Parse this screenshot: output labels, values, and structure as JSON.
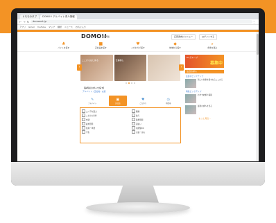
{
  "browser": {
    "tabs": [
      {
        "title": "ドモモのタブ"
      },
      {
        "title": "DOMO!! アルバイト求人情報"
      }
    ],
    "url": "domonet.jp",
    "bookmarks": [
      "アプリ",
      "Gmail",
      "YouTube",
      "マップ",
      "翻訳",
      "ニュース",
      "お気に入り"
    ]
  },
  "site": {
    "logo": "DOMO!!",
    "logo_sub": "静岡版",
    "header_buttons": [
      "応募者向けメニュー",
      "ログインする"
    ],
    "categories": [
      {
        "icon": "leaf-icon",
        "label": "バイトを探す"
      },
      {
        "icon": "case-icon",
        "label": "正社員を探す"
      },
      {
        "icon": "heart-icon",
        "label": "こだわりで探す"
      },
      {
        "icon": "map-icon",
        "label": "地域から探す"
      },
      {
        "icon": "search-icon",
        "label": "条件を選ぶ"
      }
    ],
    "hero": {
      "slides": [
        {
          "text": "ここからはじめる"
        },
        {
          "text": "仕事探し"
        },
        {
          "text": ""
        }
      ],
      "prev": "‹",
      "next": "›"
    },
    "promo_text": "【静岡県の求人を探す】",
    "promo_tags": "アルバイト / 正社員 / 派遣",
    "job_tabs": [
      {
        "icon": "paper-icon",
        "label": "アルバイト"
      },
      {
        "icon": "briefcase-icon",
        "label": "正社員"
      },
      {
        "icon": "heart-icon",
        "label": "こだわり"
      },
      {
        "icon": "clock-icon",
        "label": "時間帯"
      }
    ],
    "form_options": [
      "エリアを選ぶ",
      "職種",
      "こだわり条件",
      "給与",
      "交通",
      "勤務時間",
      "雇用形態",
      "週払い",
      "短期・単発",
      "未経験OK",
      "学生",
      "主婦・主夫"
    ],
    "sidebar": {
      "banner_small": "Dr.グループ",
      "banner_big": "募集中",
      "section_title": "注目の求人",
      "link": "注目のピックアップ",
      "items": [
        {
          "text": "新しい仕事を探すならここから"
        },
        {
          "text": "おすすめ求人情報"
        },
        {
          "text": "最新の求人を見る"
        }
      ],
      "section2": "特集ピックアップ",
      "more": "もっと見る ›"
    }
  },
  "colors": {
    "accent": "#f39325",
    "bezel": "#1d1d1f"
  }
}
